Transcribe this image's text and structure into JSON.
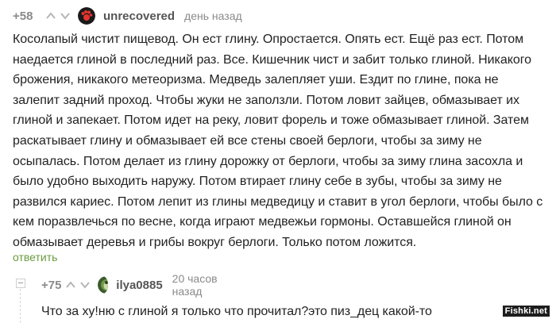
{
  "comment": {
    "rating": "+58",
    "username": "unrecovered",
    "timestamp": "день назад",
    "avatar_icon": "bear-paw-avatar",
    "text": "Косолапый чистит пищевод. Он ест глину. Опростается. Опять ест. Ещё раз ест. Потом наедается глиной в последний раз. Все. Кишечник чист и забит только глиной. Никакого брожения, никакого метеоризма. Медведь залепляет уши. Ездит по глине, пока не залепит задний проход. Чтобы жуки не заползли. Потом ловит зайцев, обмазывает их глиной и запекает. Потом идет на реку, ловит форель и тоже обмазывает глиной. Затем раскатывает глину и обмазывает ей все стены своей берлоги, чтобы за зиму не осыпалась. Потом делает из глину дорожку от берлоги, чтобы за зиму глина засохла и было удобно выходить наружу. Потом втирает глину себе в зубы, чтобы за зиму не развился кариес. Потом лепит из глины медведицу и ставит в угол берлоги, чтобы было с кем поразвлечься по весне, когда играют медвежьи гормоны. Оставшейся глиной он обмазывает деревья и грибы вокруг берлоги. Только потом ложится.",
    "reply_label": "ответить"
  },
  "reply": {
    "rating": "+75",
    "username": "ilya0885",
    "timestamp": "20 часов назад",
    "avatar_icon": "green-avatar",
    "text": "Что за ху!ню с глиной я только что прочитал?это пиз_дец какой-то"
  },
  "watermark": {
    "text": "Fishki.net"
  },
  "colors": {
    "accent_green": "#6a9b3e",
    "muted_gray": "#8a8a8a"
  }
}
